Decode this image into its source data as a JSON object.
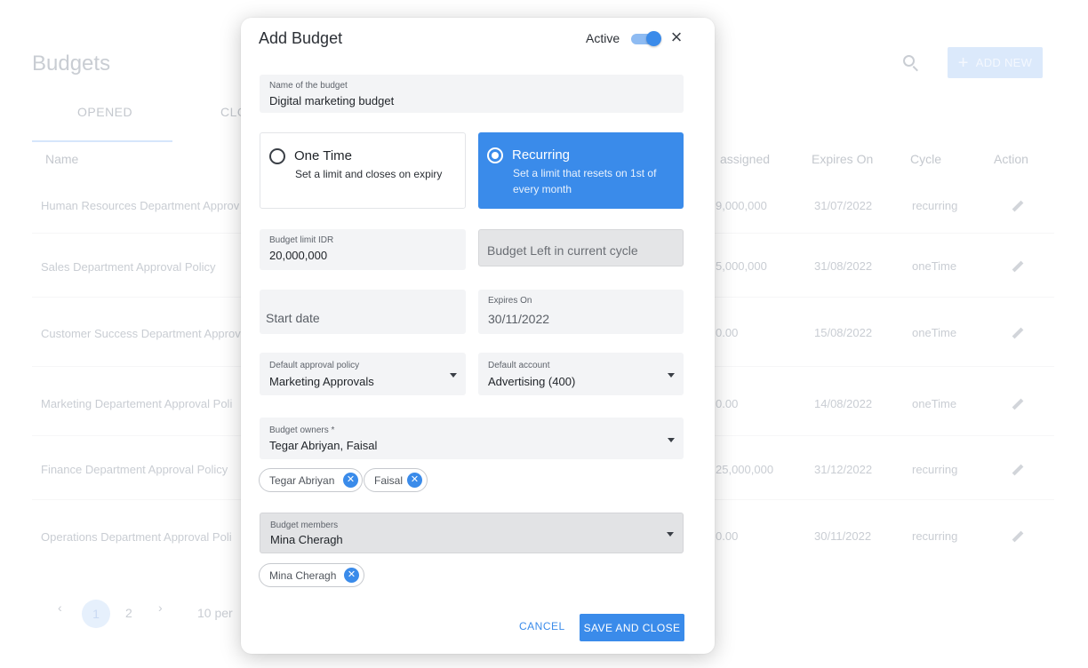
{
  "background": {
    "page_title": "Budgets",
    "add_button_label": "ADD NEW",
    "tabs": [
      "OPENED",
      "CLO"
    ],
    "columns": {
      "name": "Name",
      "assigned": "assigned",
      "expires": "Expires On",
      "cycle": "Cycle",
      "action": "Action"
    },
    "rows": [
      {
        "name": "Human Resources Department Approv",
        "assigned": "9,000,000",
        "expires": "31/07/2022",
        "cycle": "recurring"
      },
      {
        "name": "Sales Department Approval Policy",
        "assigned": "5,000,000",
        "expires": "31/08/2022",
        "cycle": "oneTime"
      },
      {
        "name": "Customer Success Department Approv",
        "assigned": "0.00",
        "expires": "15/08/2022",
        "cycle": "oneTime"
      },
      {
        "name": "Marketing Departement Approval Poli",
        "assigned": "0.00",
        "expires": "14/08/2022",
        "cycle": "oneTime"
      },
      {
        "name": "Finance Department Approval Policy",
        "assigned": "25,000,000",
        "expires": "31/12/2022",
        "cycle": "recurring"
      },
      {
        "name": "Operations Department Approval Poli",
        "assigned": "0.00",
        "expires": "30/11/2022",
        "cycle": "recurring"
      }
    ],
    "pagination": {
      "current": "1",
      "next_page": "2",
      "per_page": "10 per"
    }
  },
  "modal": {
    "title": "Add Budget",
    "active_label": "Active",
    "active": true,
    "name_field": {
      "label": "Name of the budget",
      "value": "Digital marketing budget"
    },
    "one_time": {
      "title": "One Time",
      "desc": "Set a limit and closes on expiry"
    },
    "recurring": {
      "title": "Recurring",
      "desc": "Set a limit that resets on 1st of every month",
      "selected": true
    },
    "limit_field": {
      "label": "Budget limit IDR",
      "value": "20,000,000"
    },
    "budget_left_placeholder": "Budget Left in current cycle",
    "start_date_placeholder": "Start date",
    "expires_field": {
      "label": "Expires On",
      "value": "30/11/2022"
    },
    "approval_policy": {
      "label": "Default approval policy",
      "value": "Marketing Approvals"
    },
    "default_account": {
      "label": "Default account",
      "value": "Advertising (400)"
    },
    "owners": {
      "label": "Budget owners *",
      "value": "Tegar Abriyan, Faisal",
      "chips": [
        "Tegar Abriyan",
        "Faisal"
      ]
    },
    "members": {
      "label": "Budget members",
      "value": "Mina Cheragh",
      "chips": [
        "Mina Cheragh"
      ]
    },
    "cancel_label": "CANCEL",
    "save_label": "SAVE AND CLOSE"
  },
  "colors": {
    "accent": "#3a8bea",
    "field_bg": "#f3f4f6"
  },
  "icons": {
    "close": "close-icon",
    "search": "search-icon",
    "edit": "pencil-icon",
    "dropdown": "chevron-down-icon",
    "chip_remove": "remove-chip-icon"
  }
}
